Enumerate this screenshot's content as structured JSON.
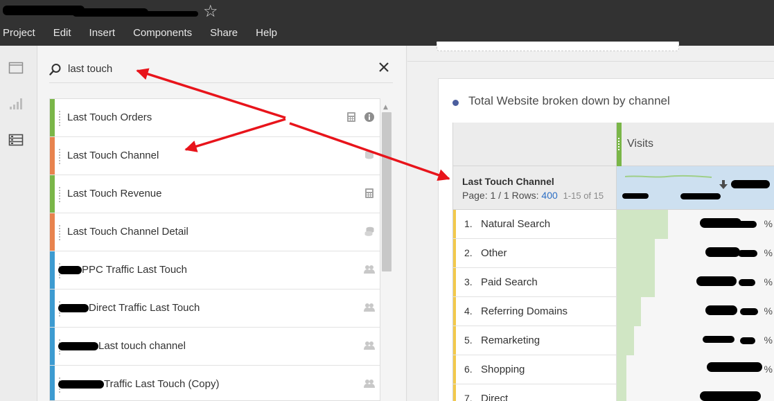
{
  "header": {
    "star_glyph": "☆",
    "menu": [
      "Project",
      "Edit",
      "Insert",
      "Components",
      "Share",
      "Help"
    ]
  },
  "rail": {
    "icons": [
      "panel-icon",
      "visualizations-icon",
      "components-icon"
    ]
  },
  "panel": {
    "search": {
      "value": "last touch",
      "placeholder": ""
    },
    "items": [
      {
        "label": "Last Touch Orders",
        "color": "#7ab648",
        "icons": [
          "calculator-icon",
          "info-icon"
        ],
        "redacted_prefix": false
      },
      {
        "label": "Last Touch Channel",
        "color": "#e8834e",
        "icons": [
          "dimension-icon"
        ],
        "redacted_prefix": false
      },
      {
        "label": "Last Touch Revenue",
        "color": "#7ab648",
        "icons": [
          "calculator-icon"
        ],
        "redacted_prefix": false
      },
      {
        "label": "Last Touch Channel Detail",
        "color": "#e8834e",
        "icons": [
          "dimension-stack-icon"
        ],
        "redacted_prefix": false
      },
      {
        "label": "PPC Traffic Last Touch",
        "color": "#3d9bd1",
        "icons": [
          "segment-icon"
        ],
        "redacted_prefix": true
      },
      {
        "label": "Direct Traffic Last Touch",
        "color": "#3d9bd1",
        "icons": [
          "segment-icon"
        ],
        "redacted_prefix": true
      },
      {
        "label": "Last touch channel",
        "color": "#3d9bd1",
        "icons": [
          "segment-icon"
        ],
        "redacted_prefix": true
      },
      {
        "label": "Traffic Last Touch (Copy)",
        "color": "#3d9bd1",
        "icons": [
          "segment-icon"
        ],
        "redacted_prefix": true
      }
    ]
  },
  "visualization": {
    "title": "Total Website broken down by channel",
    "metric_header": "Visits",
    "dimension": {
      "name": "Last Touch Channel",
      "page_prefix": "Page: ",
      "page_value": "1 / 1",
      "rows_label": " Rows: ",
      "rows_value": "400",
      "range": "1-15 of 15"
    },
    "rows": [
      {
        "rank": "1.",
        "name": "Natural Search",
        "bar": 0.32,
        "pct": "%"
      },
      {
        "rank": "2.",
        "name": "Other",
        "bar": 0.24,
        "pct": "%"
      },
      {
        "rank": "3.",
        "name": "Paid Search",
        "bar": 0.24,
        "pct": "%"
      },
      {
        "rank": "4.",
        "name": "Referring Domains",
        "bar": 0.15,
        "pct": "%"
      },
      {
        "rank": "5.",
        "name": "Remarketing",
        "bar": 0.11,
        "pct": "%"
      },
      {
        "rank": "6.",
        "name": "Shopping",
        "bar": 0.06,
        "pct": "%"
      },
      {
        "rank": "7.",
        "name": "Direct",
        "bar": 0.06,
        "pct": ""
      }
    ]
  },
  "colors": {
    "header_bg": "#323232",
    "metric_green": "#7ab648",
    "dimension_orange": "#e8834e",
    "segment_blue": "#3d9bd1",
    "annotation_red": "#e8141b"
  }
}
